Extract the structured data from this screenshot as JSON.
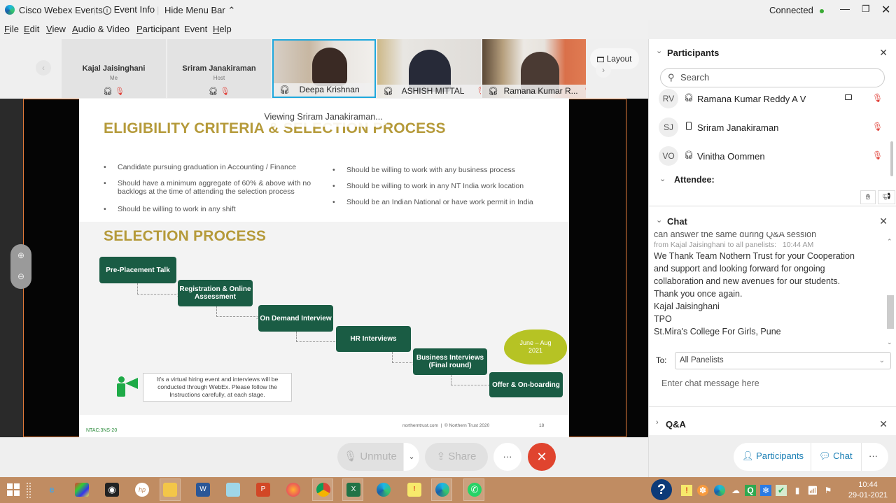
{
  "titlebar": {
    "app_name": "Cisco Webex Events",
    "event_info": "Event Info",
    "hide_menu_bar": "Hide Menu Bar",
    "status": "Connected",
    "status_color": "#3aaa35"
  },
  "menubar": {
    "items": [
      {
        "u": "F",
        "rest": "ile"
      },
      {
        "u": "E",
        "rest": "dit"
      },
      {
        "u": "V",
        "rest": "iew"
      },
      {
        "u": "A",
        "rest": "udio & Video"
      },
      {
        "u": "P",
        "rest": "articipant"
      },
      {
        "u": "",
        "rest": "Event"
      },
      {
        "u": "H",
        "rest": "elp"
      }
    ]
  },
  "thumbnails": [
    {
      "name": "Kajal Jaisinghani",
      "role": "Me",
      "video": false,
      "muted": true
    },
    {
      "name": "Sriram Janakiraman",
      "role": "Host",
      "video": false,
      "muted": true
    },
    {
      "name": "Deepa Krishnan",
      "video": true,
      "active_speaker": true,
      "muted": false
    },
    {
      "name": "ASHISH MITTAL",
      "video": true,
      "muted": true
    },
    {
      "name": "Ramana Kumar R...",
      "video": true,
      "muted": true
    }
  ],
  "layout_button": "Layout",
  "viewing_banner": "Viewing Sriram Janakiraman...",
  "slide": {
    "title": "ELIGIBILITY CRITERIA & SELECTION PROCESS",
    "left_bullets": [
      "Candidate pursuing graduation in Accounting / Finance",
      "Should have a minimum aggregate of 60% & above with no backlogs at the time of attending the selection process",
      "Should be willing to work in any shift"
    ],
    "right_bullets": [
      "Should be willing to work with any business process",
      "Should be willing to work in any NT India work location",
      "Should be an Indian National or have work permit in India"
    ],
    "section_title": "SELECTION PROCESS",
    "steps": [
      "Pre-Placement Talk",
      "Registration & Online Assessment",
      "On Demand Interview",
      "HR Interviews",
      "Business Interviews (Final round)",
      "Offer & On-boarding"
    ],
    "cloud_note": "June – Aug 2021",
    "notice": "It's a virtual hiring event and interviews will be conducted through WebEx. Please follow the Instructions carefully, at each stage.",
    "footer_left": "NTAC:3NS-20",
    "footer_center": "northerntrust.com  |  © Northern Trust 2020",
    "page_number": "18",
    "title_color": "#b59a3a",
    "step_color": "#1a5c44"
  },
  "controls": {
    "unmute": "Unmute",
    "share": "Share",
    "more": "···",
    "leave_color": "#e0442e"
  },
  "participants_panel": {
    "title": "Participants",
    "search_placeholder": "Search",
    "rows": [
      {
        "initials": "RV",
        "name": "Ramana Kumar Reddy A V",
        "device": "headset",
        "video": true,
        "muted": true
      },
      {
        "initials": "SJ",
        "name": "Sriram Janakiraman",
        "device": "phone",
        "video": false,
        "muted": true
      },
      {
        "initials": "VO",
        "name": "Vinitha Oommen",
        "device": "headset",
        "video": false,
        "muted": true
      }
    ],
    "attendee_label": "Attendee:"
  },
  "chat_panel": {
    "title": "Chat",
    "partial_line": "can answer the same during Q&A session",
    "message_meta": "from Kajal Jaisinghani to all panelists:",
    "message_time": "10:44 AM",
    "message_lines": [
      "We Thank Team Nothern Trust for your Cooperation",
      "and support and looking forward for ongoing",
      "collaboration and new avenues for our students.",
      "Thank you once again.",
      "Kajal Jaisinghani",
      "TPO",
      "St.Mira's College For Girls, Pune"
    ],
    "to_label": "To:",
    "to_value": "All Panelists",
    "input_placeholder": "Enter chat message here"
  },
  "qa_panel": {
    "title": "Q&A"
  },
  "panel_toggles": {
    "participants": "Participants",
    "chat": "Chat",
    "more": "···",
    "accent": "#1a7fb5"
  },
  "taskbar": {
    "time": "10:44",
    "date": "29-01-2021"
  }
}
